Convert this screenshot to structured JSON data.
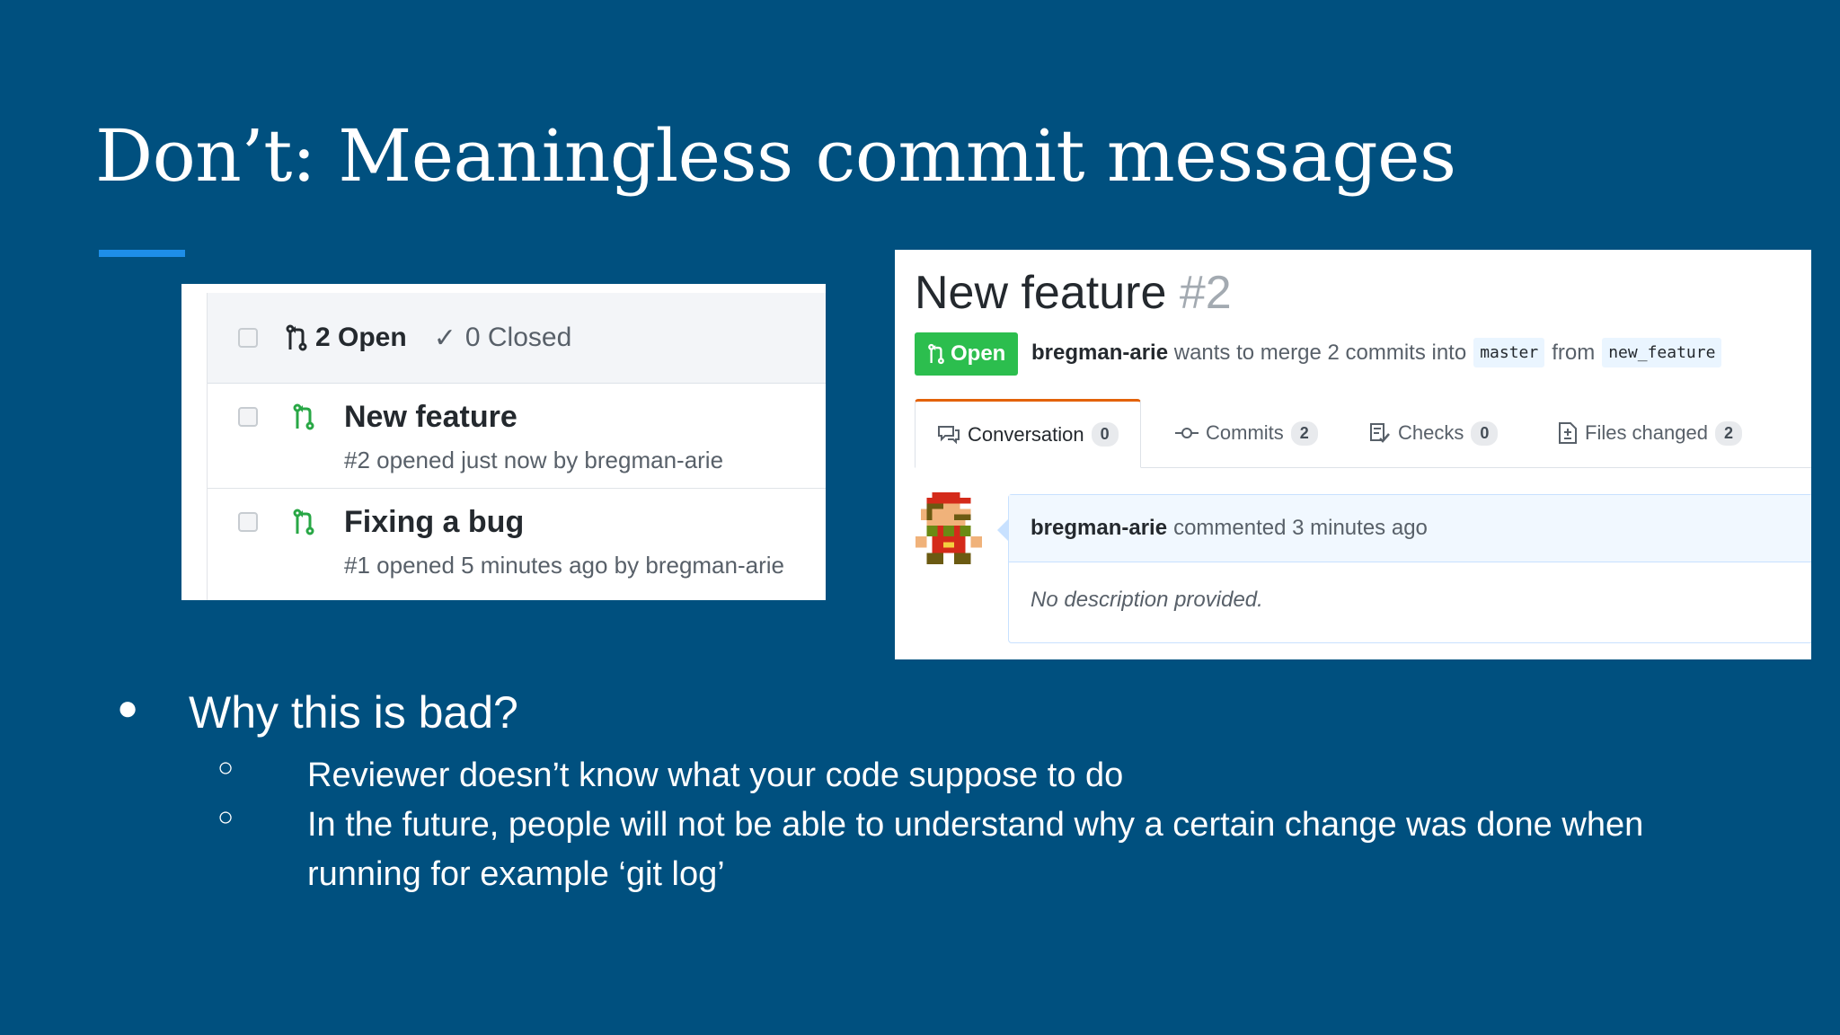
{
  "slide": {
    "title": "Don’t: Meaningless commit messages",
    "colors": {
      "background": "#00507f",
      "accent": "#1e8ee8"
    }
  },
  "pr_list": {
    "open_count": "2 Open",
    "closed_count": "0 Closed",
    "items": [
      {
        "title": "New feature",
        "meta": "#2 opened just now by bregman-arie"
      },
      {
        "title": "Fixing a bug",
        "meta": "#1 opened 5 minutes ago by bregman-arie"
      }
    ]
  },
  "pr_detail": {
    "title": "New feature",
    "number": "#2",
    "state": "Open",
    "author": "bregman-arie",
    "merge_text": "wants to merge 2 commits into",
    "base_branch": "master",
    "from_text": "from",
    "head_branch": "new_feature",
    "tabs": [
      {
        "label": "Conversation",
        "count": "0",
        "icon": "comment-icon"
      },
      {
        "label": "Commits",
        "count": "2",
        "icon": "commit-icon"
      },
      {
        "label": "Checks",
        "count": "0",
        "icon": "checklist-icon"
      },
      {
        "label": "Files changed",
        "count": "2",
        "icon": "file-diff-icon"
      }
    ],
    "comment": {
      "author": "bregman-arie",
      "action": "commented 3 minutes ago",
      "body": "No description provided."
    }
  },
  "bullets": {
    "main": "Why this is bad?",
    "sub": [
      "Reviewer doesn’t know what your code suppose to do",
      "In the future, people will not be able to understand why a certain change was done when running for example ‘git log’"
    ]
  }
}
